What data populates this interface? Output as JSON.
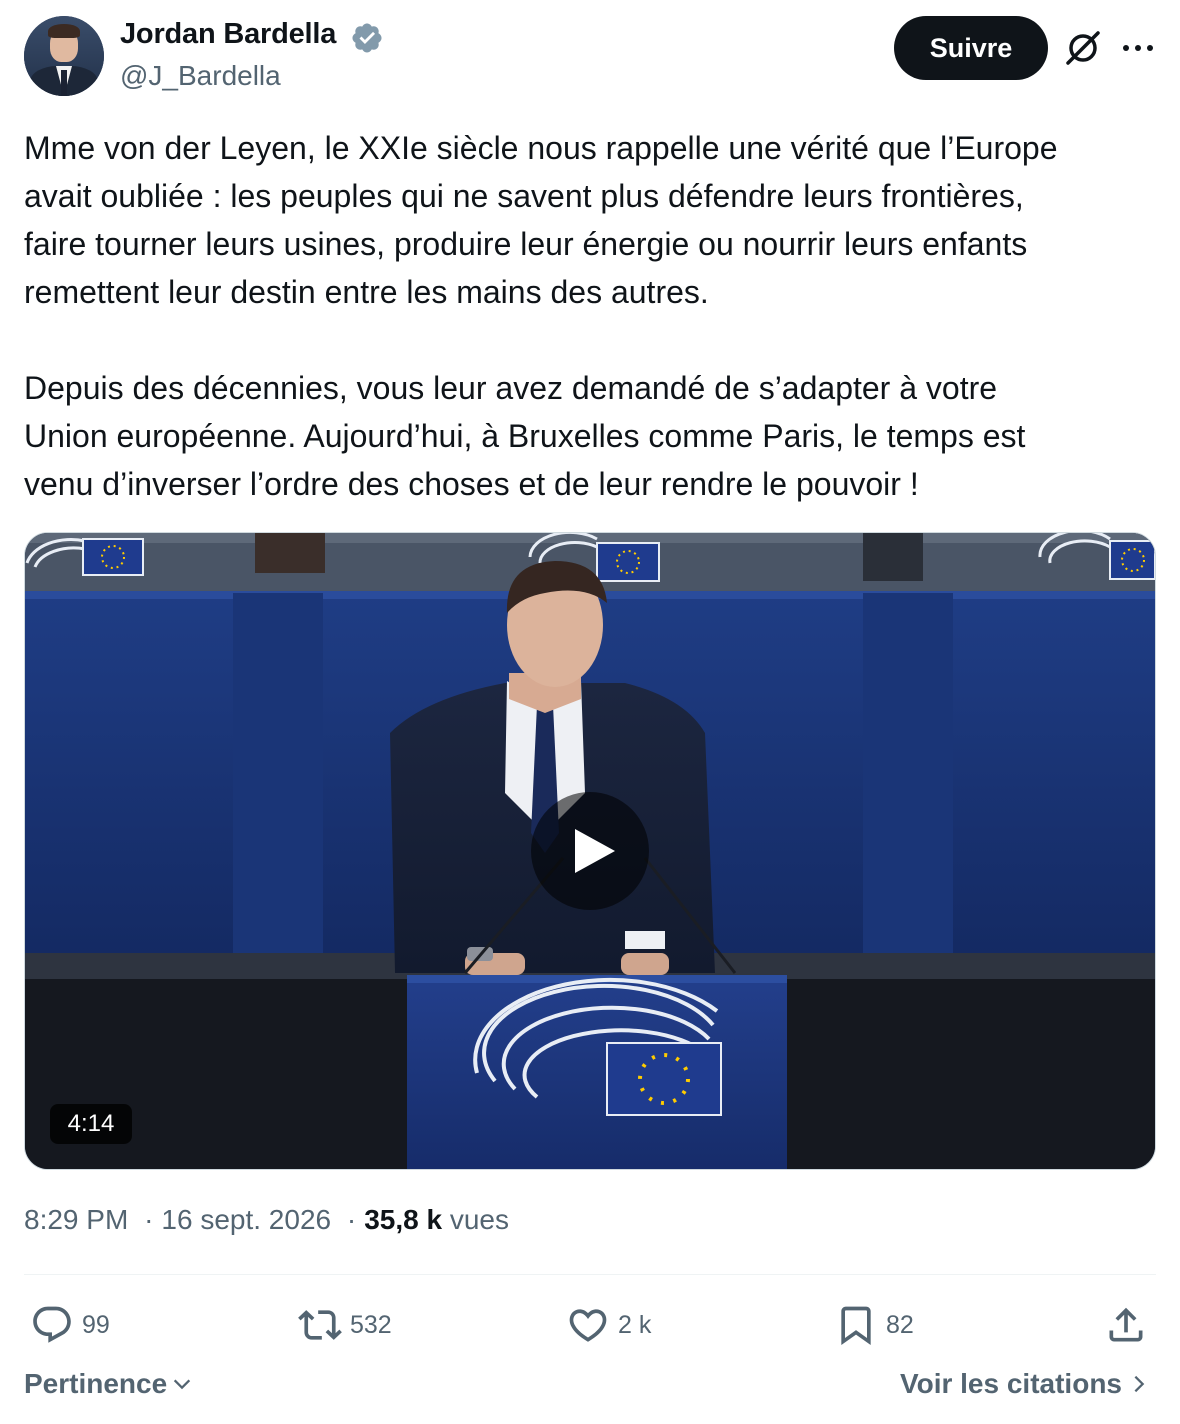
{
  "author": {
    "name": "Jordan Bardella",
    "handle": "@J_Bardella",
    "verified_icon": "verified-badge-icon",
    "verified_color": "#829aab"
  },
  "header": {
    "follow_label": "Suivre",
    "grok_icon": "grok-icon",
    "more_icon": "more-icon"
  },
  "tweet": {
    "paragraphs": [
      "Mme von der Leyen, le XXIe siècle nous rappelle une vérité que l’Europe\navait oubliée : les peuples qui ne savent plus défendre leurs frontières,\nfaire tourner leurs usines, produire leur énergie ou nourrir leurs enfants\nremettent leur destin entre les mains des autres.",
      "Depuis des décennies, vous leur avez demandé de s’adapter à votre\nUnion européenne. Aujourd’hui, à Bruxelles comme Paris, le temps est\nvenu d’inverser l’ordre des choses et de leur rendre le pouvoir !"
    ]
  },
  "media": {
    "type": "video",
    "duration": "4:14",
    "play_icon": "play-icon"
  },
  "meta": {
    "time": "8:29 PM",
    "separator": "·",
    "date": "16 sept. 2026",
    "views_count": "35,8 k",
    "views_label": "vues"
  },
  "actions": {
    "replies": "99",
    "reposts": "532",
    "likes": "2 k",
    "bookmarks": "82"
  },
  "footer": {
    "sort_label": "Pertinence",
    "quotes_label": "Voir les citations"
  },
  "colors": {
    "text": "#0f1419",
    "secondary": "#536471",
    "button_bg": "#0f1419",
    "eu_blue": "#1f3b8e",
    "eu_star": "#ffcc00"
  }
}
